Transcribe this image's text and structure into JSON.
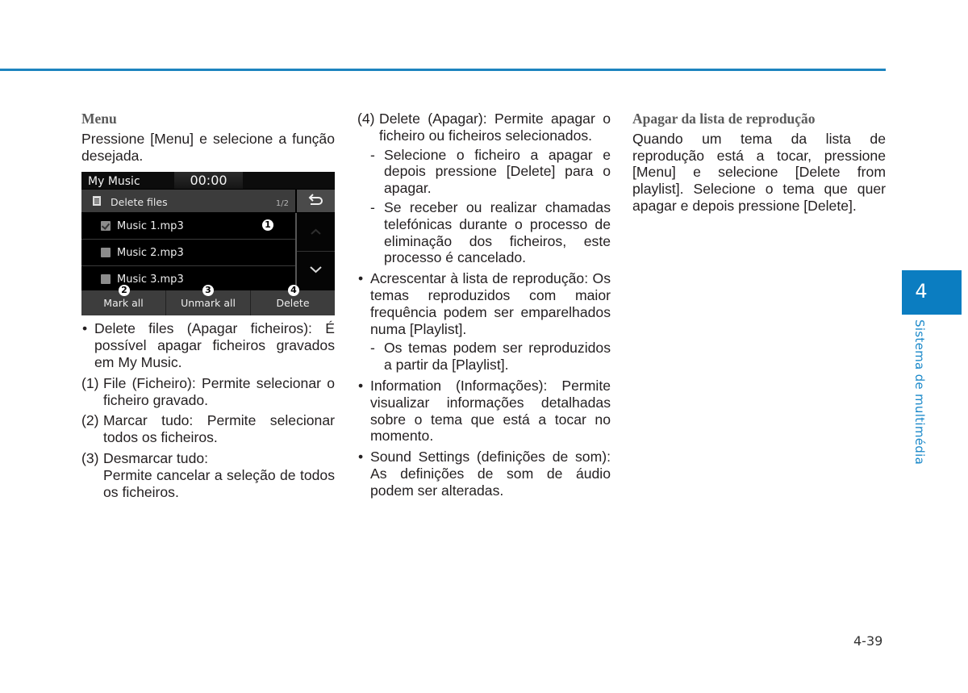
{
  "page": {
    "chapter_number": "4",
    "chapter_title": "Sistema de multimédia",
    "page_number": "4-39",
    "accent_color": "#0b7dc1"
  },
  "col1": {
    "heading": "Menu",
    "intro": "Pressione [Menu] e selecione a função desejada.",
    "screen": {
      "title": "My Music",
      "clock": "00:00",
      "header_icon": "list-icon",
      "header_title": "Delete files",
      "page_indicator": "1/2",
      "back_icon": "back-arrow-icon",
      "rows": [
        {
          "label": "Music 1.mp3",
          "checked": true
        },
        {
          "label": "Music 2.mp3",
          "checked": false
        },
        {
          "label": "Music 3.mp3",
          "checked": false
        }
      ],
      "scroll_up_icon": "chevron-up-icon",
      "scroll_down_icon": "chevron-down-icon",
      "buttons": [
        "Mark all",
        "Unmark all",
        "Delete"
      ],
      "callouts": [
        "1",
        "2",
        "3",
        "4"
      ]
    },
    "bullet": "Delete files (Apagar ficheiros): É possível apagar ficheiros gravados em My Music.",
    "items": [
      {
        "marker": "(1)",
        "text": "File (Ficheiro): Permite selecionar o ficheiro gravado."
      },
      {
        "marker": "(2)",
        "text": "Marcar tudo: Permite selecionar todos os ficheiros."
      },
      {
        "marker": "(3)",
        "text": "Desmarcar tudo:",
        "text2": "Permite cancelar a seleção de todos os ficheiros."
      }
    ]
  },
  "col2": {
    "item4": {
      "marker": "(4)",
      "text": "Delete (Apagar): Permite apagar o ficheiro ou ficheiros selecionados."
    },
    "item4_subs": [
      "Selecione o ficheiro a apagar e depois pressione [Delete] para o apagar.",
      "Se receber ou realizar chamadas telefónicas durante o processo de eliminação dos ficheiros, este processo é cancelado."
    ],
    "bullet_playlist": "Acrescentar à lista de reprodução: Os temas reproduzidos com maior frequência podem ser emparelhados numa [Playlist].",
    "playlist_sub": "Os temas podem ser reproduzidos a partir da [Playlist].",
    "bullet_info": "Information (Informações): Permite visualizar informações detalhadas sobre o tema que está a tocar no momento.",
    "bullet_sound": "Sound Settings (definições de som): As definições de som de áudio podem ser alteradas."
  },
  "col3": {
    "heading": "Apagar da lista de reprodução",
    "text": "Quando um tema da lista de reprodução está a tocar, pressione [Menu] e selecione [Delete from playlist]. Selecione o tema que quer apagar e depois pressione [Delete]."
  },
  "dash": "-"
}
